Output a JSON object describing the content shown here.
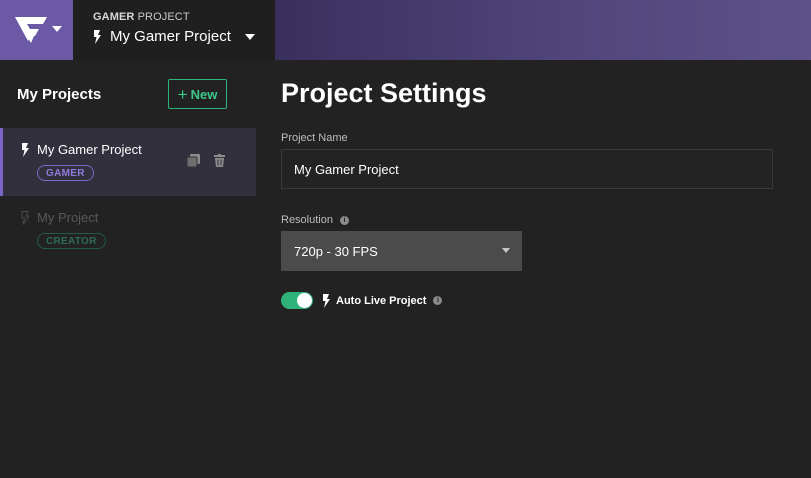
{
  "header": {
    "label_bold": "GAMER",
    "label_rest": " PROJECT",
    "project_title": "My Gamer Project"
  },
  "sidebar": {
    "title": "My Projects",
    "new_button": "New",
    "items": [
      {
        "name": "My Gamer Project",
        "badge": "GAMER",
        "active": true
      },
      {
        "name": "My Project",
        "badge": "CREATOR",
        "active": false
      }
    ]
  },
  "main": {
    "title": "Project Settings",
    "project_name_label": "Project Name",
    "project_name_value": "My Gamer Project",
    "resolution_label": "Resolution",
    "resolution_value": "720p - 30 FPS",
    "auto_live_label": "Auto Live Project",
    "auto_live_enabled": true
  },
  "colors": {
    "accent_purple": "#7c67c9",
    "accent_green": "#2fb37b",
    "logo_bg": "#6b59a6"
  },
  "icons": [
    "logo-icon",
    "bolt-icon",
    "copy-icon",
    "trash-icon",
    "info-icon",
    "chevron-down-icon",
    "plus-icon"
  ]
}
